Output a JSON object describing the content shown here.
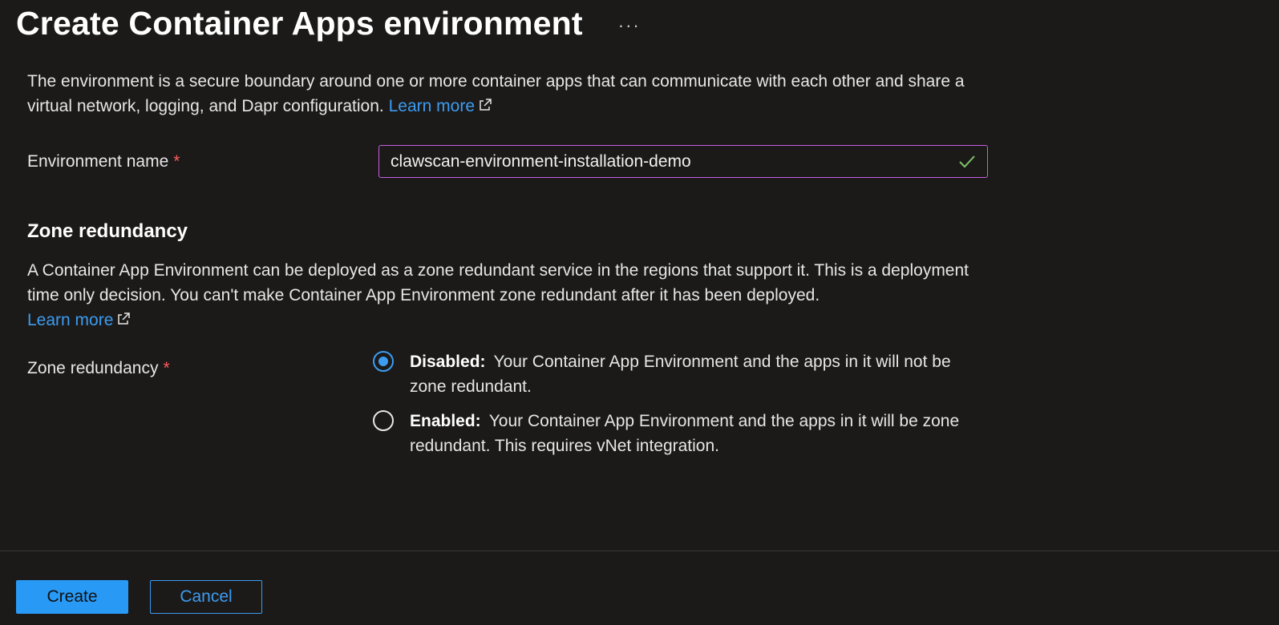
{
  "header": {
    "title": "Create Container Apps environment",
    "more_label": "···"
  },
  "intro": {
    "text": "The environment is a secure boundary around one or more container apps that can communicate with each other and share a virtual network, logging, and Dapr configuration.",
    "link": "Learn more"
  },
  "environment_name": {
    "label": "Environment name",
    "required_mark": "*",
    "value": "clawscan-environment-installation-demo",
    "valid": true
  },
  "zone_section": {
    "heading": "Zone redundancy",
    "description": "A Container App Environment can be deployed as a zone redundant service in the regions that support it. This is a deployment time only decision. You can't make Container App Environment zone redundant after it has been deployed.",
    "link": "Learn more",
    "field_label": "Zone redundancy",
    "required_mark": "*",
    "options": [
      {
        "title": "Disabled:",
        "text": "Your Container App Environment and the apps in it will not be zone redundant.",
        "selected": true
      },
      {
        "title": "Enabled:",
        "text": "Your Container App Environment and the apps in it will be zone redundant. This requires vNet integration.",
        "selected": false
      }
    ]
  },
  "footer": {
    "create_label": "Create",
    "cancel_label": "Cancel"
  },
  "colors": {
    "background": "#1b1a19",
    "accent": "#2899f5",
    "link": "#3d9bf0",
    "required": "#ff5a5a",
    "input_border": "#c65de0",
    "valid_check": "#7fc26b"
  },
  "icons": {
    "more": "more-horizontal-icon",
    "external_link": "external-link-icon",
    "valid": "checkmark-icon"
  }
}
